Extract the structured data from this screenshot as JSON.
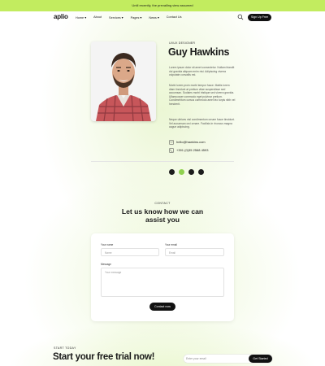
{
  "announcement": "Until recently, the prevailing view assumed",
  "nav": {
    "logo": "aplio",
    "menu": [
      "Home",
      "About",
      "Services",
      "Pages",
      "News",
      "Contact Us"
    ],
    "signup": "Sign Up Free"
  },
  "profile": {
    "role": "UI/UX DESIGNER",
    "name": "Guy Hawkins",
    "p1": "Lorem ipsum dolor sit amet consectetur. Nullam blandit dui gravida aliquam enim nisi. Adipiscing viverra vulputate convallis est.",
    "p2": "Morbi lorem proin morbi tempor fusce. Mattis lorem diam tincidunt at pretium vitae suspendisse sed accumsan. Sodales morbi tristique sed viverra gravida. Ullamcorper commodo eget pulvinar pretium. Condimentum cursus commodo amet leo turpis nibh vel hendrerit.",
    "p3": "Neque ultrices nisl condimentum ornare fusce tincidunt. Vel accumsan orci ornare. Facilisis in rhoncus magna augue adipiscing.",
    "email": "hello@hawkins.com",
    "phone": "+391 (0)35 2568 4593"
  },
  "contact": {
    "label": "CONTACT",
    "title_line1": "Let us know how we can",
    "title_line2": "assist you",
    "name_label": "Your name",
    "name_placeholder": "Name",
    "email_label": "Your email",
    "email_placeholder": "Email",
    "message_label": "Message",
    "message_placeholder": "Your message",
    "submit": "Contact now"
  },
  "trial": {
    "label": "START TODAY",
    "title": "Start your free trial now!",
    "email_placeholder": "Enter your email",
    "button": "Get Started"
  },
  "icons": {
    "search": "search-icon",
    "mail": "mail-icon",
    "phone": "phone-icon",
    "socials": [
      "facebook-icon",
      "instagram-icon",
      "github-icon",
      "dribbble-icon"
    ]
  },
  "colors": {
    "accent": "#c2ec5f",
    "social_active": "#8fd14f",
    "dark": "#111111"
  }
}
